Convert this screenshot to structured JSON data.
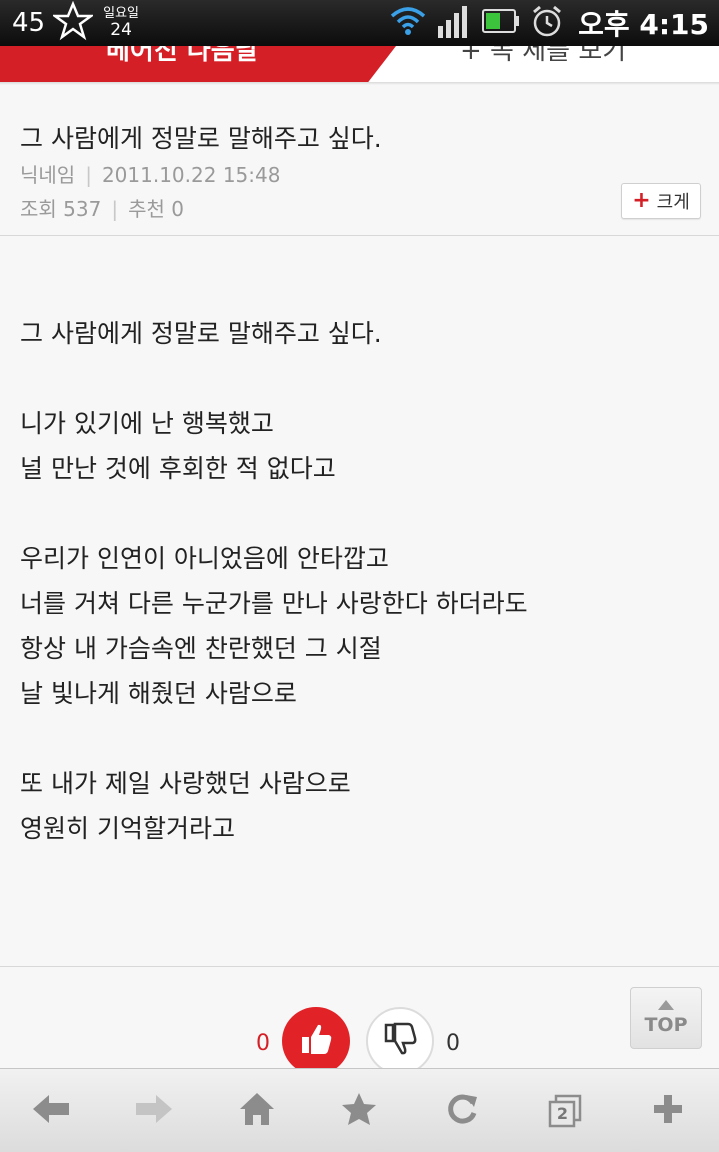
{
  "status_bar": {
    "battery_level": "45",
    "calendar_day_label": "일요일",
    "calendar_date": "24",
    "time": "오후 4:15"
  },
  "tabs": {
    "active_label": "베어진 다음날",
    "other_label": "+ 목 제를 보기"
  },
  "article": {
    "title": "그 사람에게 정말로 말해주고 싶다.",
    "nickname": "닉네임",
    "datetime": "2011.10.22 15:48",
    "views": "조회 537",
    "recommend": "추천 0",
    "size_button_label": "크게"
  },
  "poem": [
    "그 사람에게 정말로 말해주고 싶다.",
    "",
    "니가 있기에 난 행복했고",
    "널 만난 것에 후회한 적 없다고",
    "",
    "우리가 인연이 아니었음에 안타깝고",
    "너를 거쳐 다른 누군가를 만나 사랑한다 하더라도",
    "항상 내 가슴속엔 찬란했던 그 시절",
    "날 빛나게 해줬던 사람으로",
    "",
    "또 내가 제일 사랑했던 사람으로",
    "영원히 기억할거라고"
  ],
  "vote": {
    "like_count": "0",
    "dislike_count": "0",
    "top_label": "TOP"
  },
  "toolbar": {
    "tab_count": "2"
  },
  "colors": {
    "accent_red": "#d51f26",
    "status_bar_bg": "#111111"
  }
}
